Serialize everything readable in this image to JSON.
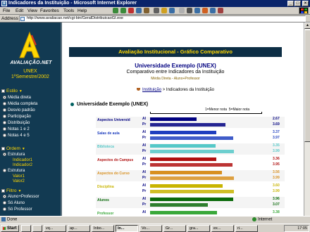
{
  "window": {
    "title": "Indicadores da Instituição - Microsoft Internet Explorer",
    "minimize": "_",
    "maximize": "□",
    "close": "×"
  },
  "menu": [
    "File",
    "Edit",
    "View",
    "Favorites",
    "Tools",
    "Help"
  ],
  "address": {
    "label": "Address",
    "url": "http://www.avaliacao.net/cgi-bin/GeralDistribuicaoGI.exe"
  },
  "sidebar": {
    "logo_letter": "A",
    "logo_text": "AVALIAÇÃO.NET",
    "institution": "UNEX",
    "semester": "1ºSemestre/2002",
    "sections": [
      {
        "title": "Estilo",
        "options": [
          {
            "label": "Média direta",
            "selected": true
          },
          {
            "label": "Média completa",
            "selected": false
          },
          {
            "label": "Desvio padrão",
            "selected": false
          },
          {
            "label": "Participação",
            "selected": false
          },
          {
            "label": "Distribuição",
            "selected": false
          },
          {
            "label": "Notas 1 e 2",
            "selected": false
          },
          {
            "label": "Notas 4 e 5",
            "selected": false
          }
        ]
      },
      {
        "title": "Ordem",
        "options": [
          {
            "label": "Estrutura",
            "selected": true,
            "sub": [
              "Indicador1",
              "Indicador2"
            ]
          },
          {
            "label": "Estrutura",
            "selected": false,
            "sub": [
              "Valor1",
              "Valor2"
            ]
          }
        ]
      },
      {
        "title": "Filtro",
        "options": [
          {
            "label": "Aluno+Professor",
            "selected": true
          },
          {
            "label": "Só Aluno",
            "selected": false
          },
          {
            "label": "Só Professor",
            "selected": false
          }
        ]
      }
    ]
  },
  "main": {
    "banner": "Avaliação Institucional - Gráfico Comparativo",
    "title": "Universidade Exemplo (UNEX)",
    "subtitle": "Comparativo entre Indicadores da Instituição",
    "filter_note": "Média Direta - Aluno+Professor",
    "breadcrumb_link": "Instituição",
    "breadcrumb_sep": ">",
    "breadcrumb_current": "Indicadores da Instituição",
    "university_label": "Universidade Exemplo (UNEX)",
    "legend_min": "1=Menor nota",
    "legend_max": "5=Maior nota"
  },
  "chart_data": {
    "type": "bar",
    "title": "Universidade Exemplo (UNEX)",
    "xlim": [
      1,
      5
    ],
    "legend": [
      "1=Menor nota",
      "5=Maior nota"
    ],
    "rows": [
      {
        "category": "Aspectos Universid",
        "color": "#000080",
        "bars": [
          {
            "code": "Al",
            "value": 2.67,
            "label": "2.67"
          },
          {
            "code": "Pr",
            "value": 3.69,
            "label": "3.69"
          }
        ]
      },
      {
        "category": "Salas de aula",
        "color": "#1f3fbf",
        "bars": [
          {
            "code": "Al",
            "value": 3.37,
            "label": "3.37"
          },
          {
            "code": "Pr",
            "value": 3.97,
            "label": "3.97"
          }
        ]
      },
      {
        "category": "Biblioteca",
        "color": "#55c8c8",
        "bars": [
          {
            "code": "Al",
            "value": 3.35,
            "label": "3.35"
          },
          {
            "code": "Pr",
            "value": 3.99,
            "label": "3.99"
          }
        ]
      },
      {
        "category": "Aspectos do Campus",
        "color": "#b01010",
        "bars": [
          {
            "code": "Al",
            "value": 3.36,
            "label": "3.36"
          },
          {
            "code": "Pr",
            "value": 3.95,
            "label": "3.95"
          }
        ]
      },
      {
        "category": "Aspectos do Curso",
        "color": "#d89020",
        "bars": [
          {
            "code": "Al",
            "value": 3.56,
            "label": "3.56"
          },
          {
            "code": "Pr",
            "value": 3.99,
            "label": "3.99"
          }
        ]
      },
      {
        "category": "Disciplina",
        "color": "#c8b400",
        "bars": [
          {
            "code": "Al",
            "value": 3.6,
            "label": "3.60"
          },
          {
            "code": "Pr",
            "value": 3.99,
            "label": "3.99"
          }
        ]
      },
      {
        "category": "Alunos",
        "color": "#0a6a0a",
        "bars": [
          {
            "code": "Al",
            "value": 3.96,
            "label": "3.96"
          },
          {
            "code": "Pr",
            "value": 3.07,
            "label": "3.07"
          }
        ]
      },
      {
        "category": "Professor",
        "color": "#3aa83a",
        "bars": [
          {
            "code": "Al",
            "value": 3.38,
            "label": "3.38"
          },
          {
            "code": "Pr",
            "value": 4.14,
            "label": "4.14"
          }
        ]
      }
    ]
  },
  "status": {
    "left": "Done",
    "zone": "Internet"
  },
  "taskbar": {
    "start": "Start",
    "tasks": [
      "vq...",
      "ap...",
      "Inbo...",
      "In...",
      "Vo...",
      "Gr...",
      "gra...",
      "ex...",
      "ri..."
    ],
    "clock": "17:05"
  }
}
